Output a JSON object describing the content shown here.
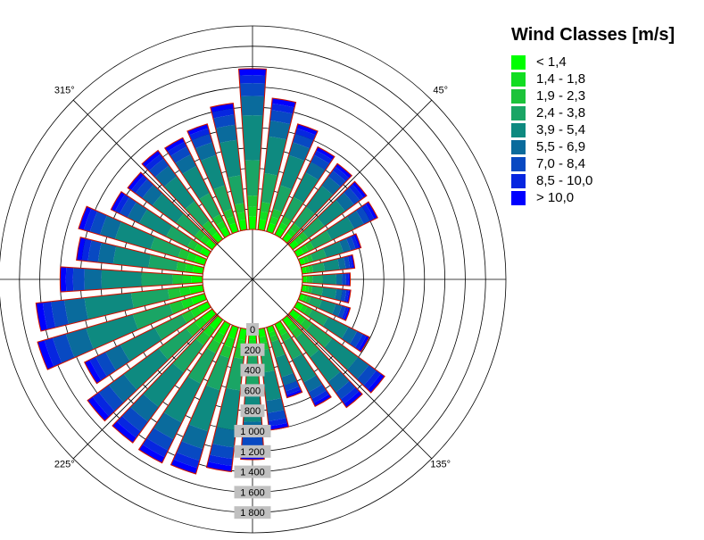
{
  "chart_data": {
    "type": "wind-rose",
    "title": "",
    "legend": {
      "title": "Wind Classes [m/s]",
      "placement": "right",
      "classes": [
        {
          "label": "< 1,4",
          "color": "#00ff00"
        },
        {
          "label": "1,4 - 1,8",
          "color": "#11dd22"
        },
        {
          "label": "1,9 - 2,3",
          "color": "#1cc33a"
        },
        {
          "label": "2,4 - 3,8",
          "color": "#1aa565"
        },
        {
          "label": "3,9 - 5,4",
          "color": "#0e8a80"
        },
        {
          "label": "5,5 - 6,9",
          "color": "#0a6b9c"
        },
        {
          "label": "7,0 - 8,4",
          "color": "#0849c2"
        },
        {
          "label": "8,5 - 10,0",
          "color": "#0626e0"
        },
        {
          "label": "> 10,0",
          "color": "#0000ff"
        }
      ]
    },
    "direction_labels": [
      {
        "angle": 315,
        "text": "315°"
      },
      {
        "angle": 45,
        "text": "45°"
      },
      {
        "angle": 225,
        "text": "225°"
      },
      {
        "angle": 135,
        "text": "135°"
      }
    ],
    "radial_axis": {
      "ticks": [
        "0",
        "200",
        "400",
        "600",
        "800",
        "1 000",
        "1 200",
        "1 400",
        "1 600",
        "1 800"
      ],
      "range": [
        0,
        2000
      ],
      "grid_step": 200
    },
    "sector_width_deg": 7.5,
    "outline_color": "#cc1100",
    "sectors": [
      {
        "direction": 0,
        "total": 1580
      },
      {
        "direction": 10,
        "total": 1300
      },
      {
        "direction": 20,
        "total": 1100
      },
      {
        "direction": 30,
        "total": 960
      },
      {
        "direction": 40,
        "total": 920
      },
      {
        "direction": 50,
        "total": 900
      },
      {
        "direction": 60,
        "total": 880
      },
      {
        "direction": 70,
        "total": 620
      },
      {
        "direction": 80,
        "total": 520
      },
      {
        "direction": 90,
        "total": 470
      },
      {
        "direction": 100,
        "total": 480
      },
      {
        "direction": 110,
        "total": 510
      },
      {
        "direction": 120,
        "total": 790
      },
      {
        "direction": 130,
        "total": 1120
      },
      {
        "direction": 140,
        "total": 1070
      },
      {
        "direction": 150,
        "total": 900
      },
      {
        "direction": 160,
        "total": 720
      },
      {
        "direction": 170,
        "total": 1000
      },
      {
        "direction": 180,
        "total": 1280
      },
      {
        "direction": 190,
        "total": 1410
      },
      {
        "direction": 200,
        "total": 1500
      },
      {
        "direction": 210,
        "total": 1520
      },
      {
        "direction": 220,
        "total": 1500
      },
      {
        "direction": 230,
        "total": 1520
      },
      {
        "direction": 240,
        "total": 1350
      },
      {
        "direction": 250,
        "total": 1710
      },
      {
        "direction": 260,
        "total": 1650
      },
      {
        "direction": 270,
        "total": 1400
      },
      {
        "direction": 280,
        "total": 1250
      },
      {
        "direction": 290,
        "total": 1290
      },
      {
        "direction": 300,
        "total": 1060
      },
      {
        "direction": 310,
        "total": 1030
      },
      {
        "direction": 320,
        "total": 1080
      },
      {
        "direction": 330,
        "total": 1060
      },
      {
        "direction": 340,
        "total": 1100
      },
      {
        "direction": 350,
        "total": 1250
      }
    ],
    "class_fractions": [
      0.08,
      0.06,
      0.07,
      0.22,
      0.28,
      0.12,
      0.08,
      0.05,
      0.04
    ]
  }
}
